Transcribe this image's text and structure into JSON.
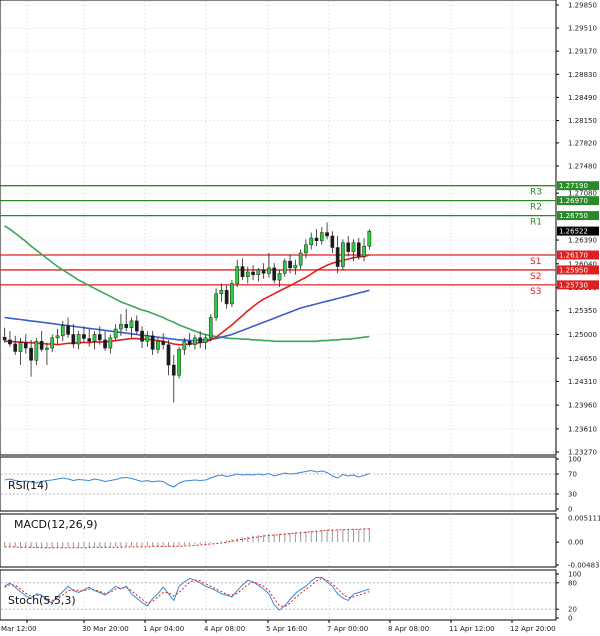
{
  "chart_data": {
    "type": "candlestick",
    "main_panel": {
      "y_ticks": [
        "1.29850",
        "1.29510",
        "1.29170",
        "1.28830",
        "1.28490",
        "1.28150",
        "1.27820",
        "1.27480",
        "1.27080",
        "1.26390",
        "1.26040",
        "1.25690",
        "1.25350",
        "1.25000",
        "1.24650",
        "1.24310",
        "1.23960",
        "1.23610",
        "1.23270"
      ],
      "y_range": [
        1.2327,
        1.2985
      ],
      "current_price": "1.26522",
      "levels": [
        {
          "name": "R3",
          "price": 1.2719,
          "label": "1.27190",
          "color": "#2a8a2a"
        },
        {
          "name": "R2",
          "price": 1.2697,
          "label": "1.26970",
          "color": "#2a8a2a"
        },
        {
          "name": "R1",
          "price": 1.2675,
          "label": "1.26750",
          "color": "#2a8a2a"
        },
        {
          "name": "S1",
          "price": 1.2617,
          "label": "1.26170",
          "color": "#e02020"
        },
        {
          "name": "S2",
          "price": 1.2595,
          "label": "1.25950",
          "color": "#e02020"
        },
        {
          "name": "S3",
          "price": 1.2573,
          "label": "1.25730",
          "color": "#e02020"
        }
      ],
      "candles": [
        {
          "o": 1.2496,
          "h": 1.251,
          "l": 1.2488,
          "c": 1.2492
        },
        {
          "o": 1.2492,
          "h": 1.2505,
          "l": 1.2482,
          "c": 1.2486
        },
        {
          "o": 1.2486,
          "h": 1.2498,
          "l": 1.247,
          "c": 1.2475
        },
        {
          "o": 1.2475,
          "h": 1.2495,
          "l": 1.2455,
          "c": 1.2488
        },
        {
          "o": 1.2488,
          "h": 1.25,
          "l": 1.2472,
          "c": 1.248
        },
        {
          "o": 1.248,
          "h": 1.2492,
          "l": 1.2438,
          "c": 1.2462
        },
        {
          "o": 1.2462,
          "h": 1.2495,
          "l": 1.2455,
          "c": 1.249
        },
        {
          "o": 1.249,
          "h": 1.2505,
          "l": 1.2475,
          "c": 1.2478
        },
        {
          "o": 1.2478,
          "h": 1.2488,
          "l": 1.2455,
          "c": 1.248
        },
        {
          "o": 1.248,
          "h": 1.25,
          "l": 1.2474,
          "c": 1.2495
        },
        {
          "o": 1.2495,
          "h": 1.2508,
          "l": 1.2485,
          "c": 1.2498
        },
        {
          "o": 1.2498,
          "h": 1.252,
          "l": 1.249,
          "c": 1.2513
        },
        {
          "o": 1.2513,
          "h": 1.2525,
          "l": 1.2495,
          "c": 1.25
        },
        {
          "o": 1.25,
          "h": 1.2515,
          "l": 1.248,
          "c": 1.2486
        },
        {
          "o": 1.2486,
          "h": 1.2505,
          "l": 1.2478,
          "c": 1.25
        },
        {
          "o": 1.25,
          "h": 1.2512,
          "l": 1.2488,
          "c": 1.2494
        },
        {
          "o": 1.2494,
          "h": 1.2508,
          "l": 1.2482,
          "c": 1.249
        },
        {
          "o": 1.249,
          "h": 1.2505,
          "l": 1.2478,
          "c": 1.25
        },
        {
          "o": 1.25,
          "h": 1.2512,
          "l": 1.2485,
          "c": 1.2492
        },
        {
          "o": 1.2492,
          "h": 1.2505,
          "l": 1.2476,
          "c": 1.248
        },
        {
          "o": 1.248,
          "h": 1.25,
          "l": 1.2472,
          "c": 1.2495
        },
        {
          "o": 1.2495,
          "h": 1.2515,
          "l": 1.249,
          "c": 1.2508
        },
        {
          "o": 1.2508,
          "h": 1.253,
          "l": 1.2498,
          "c": 1.2515
        },
        {
          "o": 1.2515,
          "h": 1.2538,
          "l": 1.2505,
          "c": 1.251
        },
        {
          "o": 1.251,
          "h": 1.2525,
          "l": 1.2495,
          "c": 1.252
        },
        {
          "o": 1.252,
          "h": 1.2528,
          "l": 1.25,
          "c": 1.2505
        },
        {
          "o": 1.2505,
          "h": 1.2512,
          "l": 1.248,
          "c": 1.249
        },
        {
          "o": 1.249,
          "h": 1.2505,
          "l": 1.2482,
          "c": 1.2498
        },
        {
          "o": 1.2498,
          "h": 1.2505,
          "l": 1.247,
          "c": 1.2478
        },
        {
          "o": 1.2478,
          "h": 1.2495,
          "l": 1.2472,
          "c": 1.249
        },
        {
          "o": 1.249,
          "h": 1.2502,
          "l": 1.2478,
          "c": 1.2485
        },
        {
          "o": 1.2485,
          "h": 1.2492,
          "l": 1.244,
          "c": 1.2455
        },
        {
          "o": 1.2455,
          "h": 1.247,
          "l": 1.24,
          "c": 1.244
        },
        {
          "o": 1.244,
          "h": 1.2482,
          "l": 1.2435,
          "c": 1.2478
        },
        {
          "o": 1.2478,
          "h": 1.2495,
          "l": 1.247,
          "c": 1.249
        },
        {
          "o": 1.249,
          "h": 1.2502,
          "l": 1.2482,
          "c": 1.2485
        },
        {
          "o": 1.2485,
          "h": 1.25,
          "l": 1.2478,
          "c": 1.2495
        },
        {
          "o": 1.2495,
          "h": 1.2505,
          "l": 1.248,
          "c": 1.2488
        },
        {
          "o": 1.2488,
          "h": 1.25,
          "l": 1.2478,
          "c": 1.2495
        },
        {
          "o": 1.2495,
          "h": 1.253,
          "l": 1.249,
          "c": 1.2525
        },
        {
          "o": 1.2525,
          "h": 1.2568,
          "l": 1.252,
          "c": 1.256
        },
        {
          "o": 1.256,
          "h": 1.2575,
          "l": 1.2548,
          "c": 1.2565
        },
        {
          "o": 1.2565,
          "h": 1.2572,
          "l": 1.2538,
          "c": 1.2545
        },
        {
          "o": 1.2545,
          "h": 1.258,
          "l": 1.254,
          "c": 1.2575
        },
        {
          "o": 1.2575,
          "h": 1.261,
          "l": 1.257,
          "c": 1.26
        },
        {
          "o": 1.26,
          "h": 1.2612,
          "l": 1.258,
          "c": 1.2585
        },
        {
          "o": 1.2585,
          "h": 1.26,
          "l": 1.2575,
          "c": 1.2592
        },
        {
          "o": 1.2592,
          "h": 1.2602,
          "l": 1.258,
          "c": 1.2588
        },
        {
          "o": 1.2588,
          "h": 1.2598,
          "l": 1.2578,
          "c": 1.2595
        },
        {
          "o": 1.2595,
          "h": 1.2605,
          "l": 1.2582,
          "c": 1.259
        },
        {
          "o": 1.259,
          "h": 1.262,
          "l": 1.2584,
          "c": 1.2598
        },
        {
          "o": 1.2598,
          "h": 1.2605,
          "l": 1.2575,
          "c": 1.258
        },
        {
          "o": 1.258,
          "h": 1.2595,
          "l": 1.257,
          "c": 1.259
        },
        {
          "o": 1.259,
          "h": 1.2612,
          "l": 1.2585,
          "c": 1.2608
        },
        {
          "o": 1.2608,
          "h": 1.2618,
          "l": 1.259,
          "c": 1.2598
        },
        {
          "o": 1.2598,
          "h": 1.261,
          "l": 1.2588,
          "c": 1.2602
        },
        {
          "o": 1.2602,
          "h": 1.2625,
          "l": 1.2596,
          "c": 1.262
        },
        {
          "o": 1.262,
          "h": 1.264,
          "l": 1.2612,
          "c": 1.2632
        },
        {
          "o": 1.2632,
          "h": 1.265,
          "l": 1.2625,
          "c": 1.2642
        },
        {
          "o": 1.2642,
          "h": 1.2655,
          "l": 1.263,
          "c": 1.2638
        },
        {
          "o": 1.2638,
          "h": 1.2658,
          "l": 1.2632,
          "c": 1.265
        },
        {
          "o": 1.265,
          "h": 1.2665,
          "l": 1.264,
          "c": 1.2645
        },
        {
          "o": 1.2645,
          "h": 1.2652,
          "l": 1.262,
          "c": 1.2628
        },
        {
          "o": 1.2628,
          "h": 1.2645,
          "l": 1.259,
          "c": 1.26
        },
        {
          "o": 1.26,
          "h": 1.264,
          "l": 1.2595,
          "c": 1.2635
        },
        {
          "o": 1.2635,
          "h": 1.2645,
          "l": 1.2615,
          "c": 1.2622
        },
        {
          "o": 1.2622,
          "h": 1.264,
          "l": 1.2608,
          "c": 1.2635
        },
        {
          "o": 1.2635,
          "h": 1.2642,
          "l": 1.261,
          "c": 1.2615
        },
        {
          "o": 1.2615,
          "h": 1.2642,
          "l": 1.2608,
          "c": 1.263
        },
        {
          "o": 1.263,
          "h": 1.2655,
          "l": 1.2625,
          "c": 1.2652
        }
      ],
      "ma_green": [
        1.266,
        1.2655,
        1.2649,
        1.2643,
        1.2637,
        1.263,
        1.2624,
        1.2618,
        1.2612,
        1.2606,
        1.26,
        1.2595,
        1.259,
        1.2585,
        1.258,
        1.2576,
        1.2572,
        1.2568,
        1.2564,
        1.256,
        1.2556,
        1.2552,
        1.2548,
        1.2545,
        1.2542,
        1.2539,
        1.2536,
        1.2534,
        1.2531,
        1.2528,
        1.2525,
        1.2521,
        1.2518,
        1.2514,
        1.2511,
        1.2508,
        1.2505,
        1.2502,
        1.25,
        1.2498,
        1.2497,
        1.2496,
        1.2495,
        1.2494,
        1.2494,
        1.2493,
        1.2493,
        1.2492,
        1.2492,
        1.2491,
        1.2491,
        1.249,
        1.249,
        1.249,
        1.249,
        1.249,
        1.249,
        1.249,
        1.249,
        1.249,
        1.2491,
        1.2491,
        1.2492,
        1.2492,
        1.2493,
        1.2493,
        1.2494,
        1.2495,
        1.2496,
        1.2497
      ],
      "ma_blue": [
        1.2525,
        1.2524,
        1.2523,
        1.2522,
        1.2521,
        1.252,
        1.2519,
        1.2518,
        1.2517,
        1.2516,
        1.2515,
        1.2514,
        1.2513,
        1.2512,
        1.2511,
        1.251,
        1.2509,
        1.2508,
        1.2507,
        1.2506,
        1.2505,
        1.2504,
        1.2503,
        1.2502,
        1.2501,
        1.25,
        1.2499,
        1.2498,
        1.2497,
        1.2496,
        1.2495,
        1.2494,
        1.2493,
        1.2492,
        1.2492,
        1.2491,
        1.2491,
        1.2492,
        1.2492,
        1.2493,
        1.2494,
        1.2496,
        1.2498,
        1.25,
        1.2503,
        1.2506,
        1.2509,
        1.2512,
        1.2515,
        1.2518,
        1.2521,
        1.2524,
        1.2527,
        1.253,
        1.2533,
        1.2536,
        1.2539,
        1.2541,
        1.2543,
        1.2545,
        1.2547,
        1.2549,
        1.2551,
        1.2553,
        1.2555,
        1.2557,
        1.2559,
        1.2561,
        1.2563,
        1.2565
      ],
      "ma_red": [
        1.249,
        1.249,
        1.2489,
        1.2489,
        1.2488,
        1.2488,
        1.2487,
        1.2487,
        1.2486,
        1.2486,
        1.2485,
        1.2486,
        1.2487,
        1.2487,
        1.2488,
        1.2488,
        1.2488,
        1.2489,
        1.2489,
        1.2489,
        1.249,
        1.2491,
        1.2492,
        1.2493,
        1.2494,
        1.2494,
        1.2493,
        1.2493,
        1.2492,
        1.2491,
        1.249,
        1.2488,
        1.2486,
        1.2485,
        1.2485,
        1.2486,
        1.2487,
        1.2488,
        1.2489,
        1.2492,
        1.2496,
        1.2502,
        1.2508,
        1.2514,
        1.2521,
        1.2528,
        1.2535,
        1.2541,
        1.2547,
        1.2552,
        1.2556,
        1.256,
        1.2564,
        1.2568,
        1.2572,
        1.2576,
        1.258,
        1.2584,
        1.2589,
        1.2594,
        1.2598,
        1.2602,
        1.2605,
        1.2607,
        1.2609,
        1.2611,
        1.2613,
        1.2614,
        1.2615,
        1.2617
      ]
    },
    "rsi_panel": {
      "label": "RSI(14)",
      "y_ticks": [
        "100",
        "70",
        "30",
        "0"
      ],
      "values": [
        58,
        60,
        57,
        55,
        56,
        54,
        52,
        55,
        57,
        58,
        60,
        62,
        60,
        57,
        59,
        58,
        57,
        60,
        58,
        55,
        57,
        59,
        62,
        63,
        61,
        58,
        55,
        57,
        54,
        56,
        55,
        48,
        44,
        52,
        56,
        57,
        58,
        57,
        58,
        62,
        66,
        68,
        65,
        67,
        70,
        68,
        69,
        68,
        70,
        68,
        71,
        66,
        69,
        72,
        70,
        71,
        73,
        75,
        77,
        74,
        76,
        73,
        66,
        62,
        69,
        66,
        68,
        64,
        67,
        71
      ]
    },
    "macd_panel": {
      "label": "MACD(12,26,9)",
      "y_ticks": [
        "0.005111",
        "0.00",
        "-0.004835"
      ],
      "hist": [
        -0.001,
        -0.0011,
        -0.0011,
        -0.0012,
        -0.0012,
        -0.0013,
        -0.0013,
        -0.0013,
        -0.0013,
        -0.0013,
        -0.0012,
        -0.0012,
        -0.0011,
        -0.0011,
        -0.0011,
        -0.0011,
        -0.0011,
        -0.0011,
        -0.0011,
        -0.0011,
        -0.0011,
        -0.001,
        -0.001,
        -0.001,
        -0.0009,
        -0.0009,
        -0.0009,
        -0.0009,
        -0.0009,
        -0.0009,
        -0.0009,
        -0.0009,
        -0.0008,
        -0.0008,
        -0.0007,
        -0.0006,
        -0.0005,
        -0.0004,
        -0.0003,
        -0.0002,
        -0.0001,
        0.0002,
        0.0004,
        0.0006,
        0.0008,
        0.001,
        0.0012,
        0.0014,
        0.0015,
        0.0016,
        0.0017,
        0.0017,
        0.0018,
        0.0019,
        0.002,
        0.0021,
        0.0022,
        0.0023,
        0.0024,
        0.0025,
        0.0026,
        0.0027,
        0.0027,
        0.0027,
        0.0028,
        0.0028,
        0.0028,
        0.0028,
        0.0028,
        0.0029
      ],
      "signal": [
        -0.001,
        -0.001,
        -0.001,
        -0.0011,
        -0.0011,
        -0.0011,
        -0.0011,
        -0.0012,
        -0.0012,
        -0.0012,
        -0.0012,
        -0.0012,
        -0.0012,
        -0.0012,
        -0.0012,
        -0.0012,
        -0.0011,
        -0.0011,
        -0.0011,
        -0.0011,
        -0.0011,
        -0.0011,
        -0.0011,
        -0.001,
        -0.001,
        -0.001,
        -0.001,
        -0.001,
        -0.0009,
        -0.0009,
        -0.0009,
        -0.0009,
        -0.0009,
        -0.0009,
        -0.0008,
        -0.0008,
        -0.0007,
        -0.0006,
        -0.0005,
        -0.0004,
        -0.0003,
        -0.0002,
        0.0,
        0.0002,
        0.0004,
        0.0006,
        0.0008,
        0.001,
        0.0011,
        0.0013,
        0.0014,
        0.0015,
        0.0016,
        0.0017,
        0.0018,
        0.0019,
        0.002,
        0.0021,
        0.0022,
        0.0023,
        0.0024,
        0.0025,
        0.0025,
        0.0026,
        0.0026,
        0.0027,
        0.0027,
        0.0027,
        0.0028,
        0.0028
      ]
    },
    "stoch_panel": {
      "label": "Stoch(5,5,3)",
      "y_ticks": [
        "100",
        "80",
        "20",
        "0"
      ],
      "k": [
        72,
        80,
        70,
        60,
        50,
        45,
        55,
        52,
        40,
        35,
        48,
        60,
        72,
        62,
        58,
        64,
        70,
        62,
        58,
        52,
        62,
        72,
        66,
        72,
        55,
        45,
        35,
        28,
        44,
        55,
        70,
        55,
        40,
        72,
        82,
        90,
        86,
        80,
        72,
        68,
        62,
        55,
        52,
        48,
        62,
        75,
        86,
        82,
        74,
        66,
        55,
        30,
        18,
        28,
        42,
        56,
        65,
        72,
        84,
        92,
        92,
        82,
        72,
        55,
        45,
        40,
        54,
        58,
        62,
        66
      ],
      "d": [
        70,
        76,
        74,
        66,
        56,
        50,
        52,
        50,
        44,
        40,
        44,
        52,
        62,
        64,
        62,
        62,
        66,
        64,
        60,
        56,
        58,
        66,
        68,
        70,
        62,
        52,
        42,
        34,
        38,
        48,
        58,
        58,
        50,
        58,
        70,
        82,
        86,
        84,
        78,
        72,
        66,
        60,
        54,
        52,
        56,
        66,
        76,
        82,
        78,
        72,
        62,
        44,
        28,
        26,
        34,
        46,
        56,
        65,
        74,
        84,
        90,
        86,
        78,
        66,
        54,
        46,
        48,
        52,
        56,
        60
      ]
    },
    "x_labels": [
      "Mar 12:00",
      "30 Mar 20:00",
      "1 Apr 04:00",
      "4 Apr 08:00",
      "5 Apr 16:00",
      "7 Apr 00:00",
      "8 Apr 08:00",
      "11 Apr 12:00",
      "12 Apr 20:00"
    ]
  }
}
